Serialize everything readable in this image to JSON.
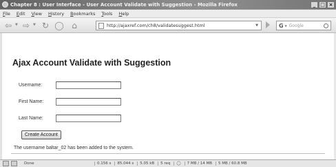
{
  "window": {
    "title": "Chapter 8 : User Interface - User Account Validate with Suggestion - Mozilla Firefox",
    "buttons": [
      "_",
      "□",
      "×"
    ]
  },
  "menu": [
    "File",
    "Edit",
    "View",
    "History",
    "Bookmarks",
    "Tools",
    "Help"
  ],
  "toolbar": {
    "url": "http://ajaxref.com/ch8/validatesuggest.html",
    "search_engine": "G",
    "search_placeholder": "Google"
  },
  "page": {
    "heading": "Ajax Account Validate with Suggestion",
    "fields": [
      {
        "label": "Username:",
        "value": ""
      },
      {
        "label": "First Name:",
        "value": ""
      },
      {
        "label": "Last Name:",
        "value": ""
      }
    ],
    "button_label": "Create Account",
    "message": "The username baltar_02 has been added to the system."
  },
  "statusbar": {
    "text": "Done",
    "cells": [
      "0.156 s",
      "85.044 s",
      "5.05 kB",
      "5 req",
      "7 MB / 14 MB",
      "5 MB / 60.8 MB"
    ]
  }
}
